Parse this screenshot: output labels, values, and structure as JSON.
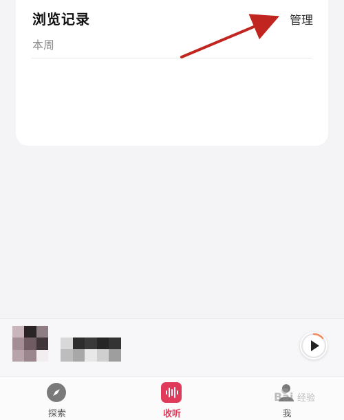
{
  "card": {
    "title": "浏览记录",
    "manage_label": "管理",
    "section_label": "本周"
  },
  "player": {
    "cover_icon": "album-cover-pixelated",
    "title_icon": "track-title-pixelated",
    "play_icon": "play-icon"
  },
  "tabbar": {
    "tabs": [
      {
        "label": "探索",
        "icon": "compass-icon",
        "active": false
      },
      {
        "label": "收听",
        "icon": "soundwave-icon",
        "active": true
      },
      {
        "label": "我",
        "icon": "user-icon",
        "active": false
      }
    ]
  },
  "colors": {
    "accent": "#e03a5a",
    "arrow": "#c0261f",
    "progress_ring": "#f08a5d"
  }
}
